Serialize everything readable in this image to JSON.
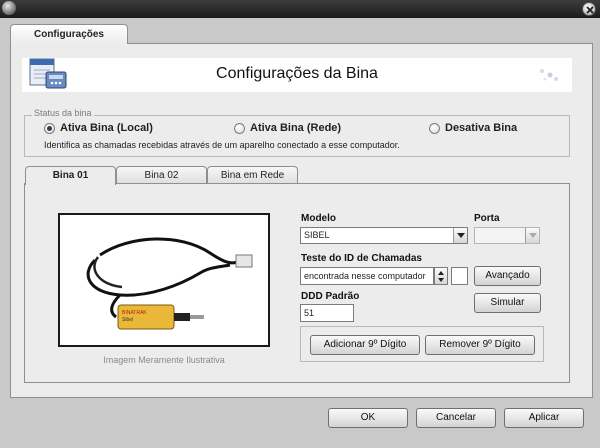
{
  "main_tab": "Configurações",
  "header": {
    "title": "Configurações da Bina"
  },
  "status": {
    "legend": "Status da bina",
    "options": [
      "Ativa Bina (Local)",
      "Ativa Bina (Rede)",
      "Desativa Bina"
    ],
    "selected": "Ativa Bina (Local)",
    "description": "Identifica as chamadas recebidas através de um aparelho conectado a esse computador."
  },
  "tabs": [
    "Bina 01",
    "Bina 02",
    "Bina em Rede"
  ],
  "active_tab": "Bina 01",
  "image_caption": "Imagem Meramente Ilustrativa",
  "device_label_lines": [
    "BINATRAK",
    "Sibel"
  ],
  "modelo": {
    "label": "Modelo",
    "value": "SIBEL"
  },
  "porta": {
    "label": "Porta",
    "value": ""
  },
  "teste": {
    "label": "Teste do ID de Chamadas",
    "value": "encontrada nesse computador",
    "extra": ""
  },
  "ddd": {
    "label": "DDD Padrão",
    "value": "51"
  },
  "buttons": {
    "avancado": "Avançado",
    "simular": "Simular",
    "adicionar": "Adicionar 9º Dígito",
    "remover": "Remover 9º Dígito",
    "ok": "OK",
    "cancelar": "Cancelar",
    "aplicar": "Aplicar"
  },
  "colors": {
    "titlebar": "#2a2a2a",
    "panel": "#ececec",
    "radio_dot": "#2f3c55"
  }
}
